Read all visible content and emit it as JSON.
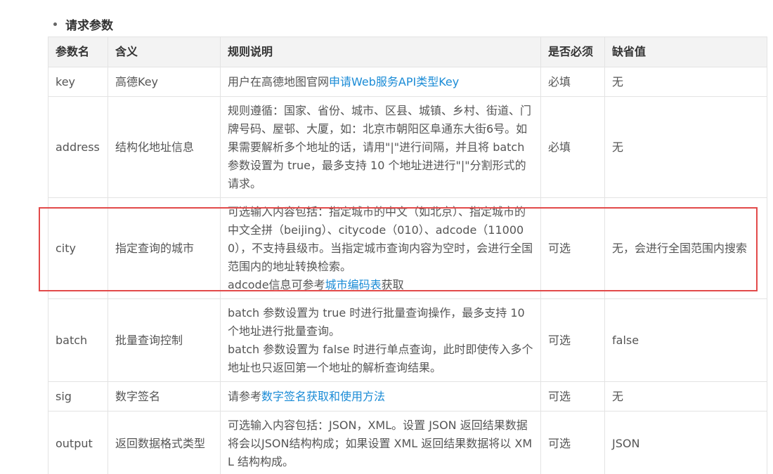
{
  "section": {
    "title": "请求参数"
  },
  "table": {
    "headers": [
      "参数名",
      "含义",
      "规则说明",
      "是否必须",
      "缺省值"
    ],
    "rows": [
      {
        "name": "key",
        "meaning": "高德Key",
        "rule_pre": "用户在高德地图官网",
        "rule_link": "申请Web服务API类型Key",
        "rule_post": "",
        "rule_line2": "",
        "required": "必填",
        "default": "无"
      },
      {
        "name": "address",
        "meaning": "结构化地址信息",
        "rule_pre": "规则遵循：国家、省份、城市、区县、城镇、乡村、街道、门牌号码、屋邨、大厦，如：北京市朝阳区阜通东大街6号。如果需要解析多个地址的话，请用\"|\"进行间隔，并且将 batch 参数设置为 true，最多支持 10 个地址进进行\"|\"分割形式的请求。",
        "rule_link": "",
        "rule_post": "",
        "rule_line2": "",
        "required": "必填",
        "default": "无"
      },
      {
        "name": "city",
        "meaning": "指定查询的城市",
        "rule_pre": "可选输入内容包括：指定城市的中文（如北京）、指定城市的中文全拼（beijing）、citycode（010）、adcode（110000），不支持县级市。当指定城市查询内容为空时，会进行全国范围内的地址转换检索。",
        "rule_line2": "adcode信息可参考",
        "rule_link": "城市编码表",
        "rule_post": "获取",
        "required": "可选",
        "default": "无，会进行全国范围内搜索"
      },
      {
        "name": "batch",
        "meaning": "批量查询控制",
        "rule_pre": "batch 参数设置为 true 时进行批量查询操作，最多支持 10 个地址进行批量查询。",
        "rule_line2": "batch 参数设置为 false 时进行单点查询，此时即使传入多个地址也只返回第一个地址的解析查询结果。",
        "rule_link": "",
        "rule_post": "",
        "required": "可选",
        "default": "false"
      },
      {
        "name": "sig",
        "meaning": "数字签名",
        "rule_pre": "请参考",
        "rule_link": "数字签名获取和使用方法",
        "rule_post": "",
        "rule_line2": "",
        "required": "可选",
        "default": "无"
      },
      {
        "name": "output",
        "meaning": "返回数据格式类型",
        "rule_pre": "可选输入内容包括：JSON，XML。设置 JSON 返回结果数据将会以JSON结构构成；如果设置 XML 返回结果数据将以 XML 结构构成。",
        "rule_link": "",
        "rule_post": "",
        "rule_line2": "",
        "required": "可选",
        "default": "JSON"
      }
    ]
  },
  "colors": {
    "link": "#1a8bd6",
    "highlight": "#e24a4a",
    "header_bg": "#f3f3f3",
    "border": "#e3e3e3"
  }
}
